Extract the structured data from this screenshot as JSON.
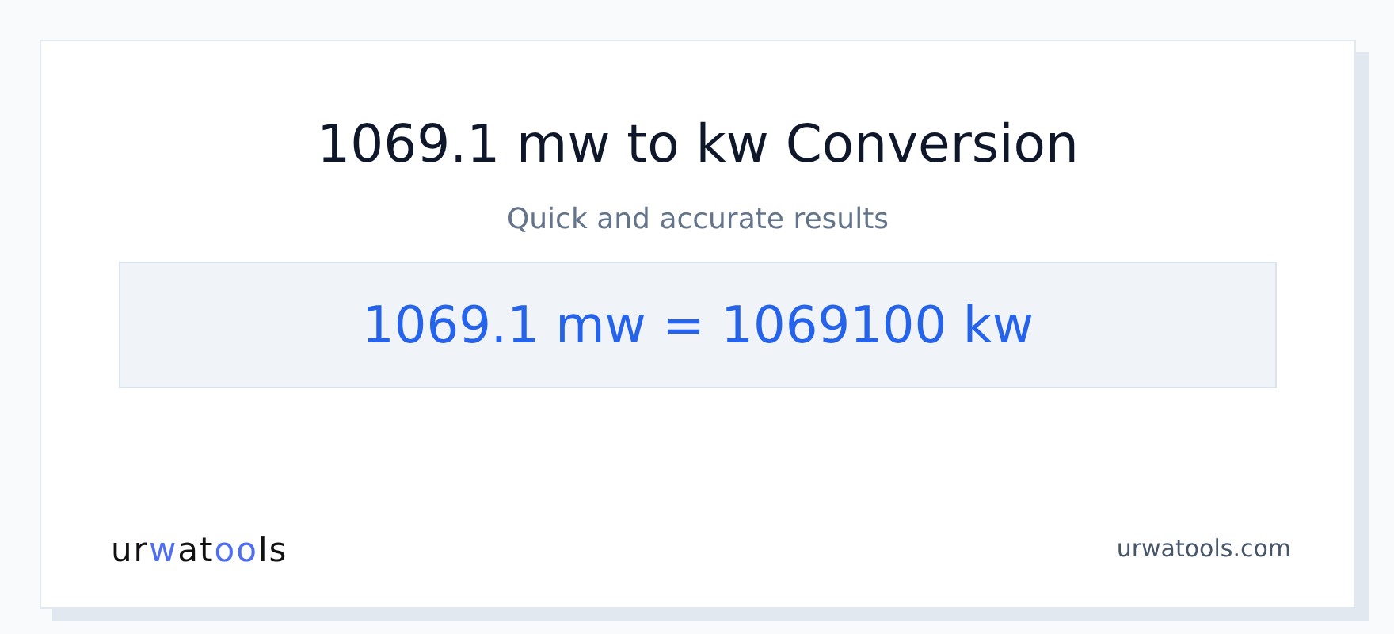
{
  "title": "1069.1 mw to kw Conversion",
  "subtitle": "Quick and accurate results",
  "result": "1069.1 mw = 1069100 kw",
  "logo": [
    {
      "text": "ur",
      "accent": false
    },
    {
      "text": "w",
      "accent": true
    },
    {
      "text": "at",
      "accent": false
    },
    {
      "text": "oo",
      "accent": true
    },
    {
      "text": "ls",
      "accent": false
    }
  ],
  "site": "urwatools.com"
}
